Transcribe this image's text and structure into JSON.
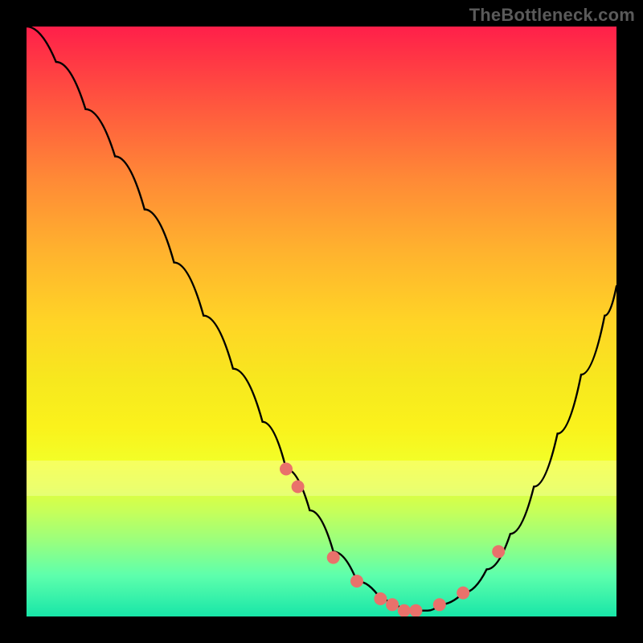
{
  "watermark": "TheBottleneck.com",
  "chart_data": {
    "type": "line",
    "title": "",
    "xlabel": "",
    "ylabel": "",
    "xlim": [
      0,
      100
    ],
    "ylim": [
      0,
      100
    ],
    "grid": false,
    "legend": false,
    "series": [
      {
        "name": "bottleneck-curve",
        "x": [
          0,
          5,
          10,
          15,
          20,
          25,
          30,
          35,
          40,
          44,
          48,
          52,
          56,
          60,
          62,
          64,
          66,
          68,
          70,
          74,
          78,
          82,
          86,
          90,
          94,
          98,
          100
        ],
        "y": [
          100,
          94,
          86,
          78,
          69,
          60,
          51,
          42,
          33,
          25,
          18,
          11,
          6,
          3,
          2,
          1,
          1,
          1,
          2,
          4,
          8,
          14,
          22,
          31,
          41,
          51,
          56
        ]
      }
    ],
    "markers": {
      "name": "threshold-points",
      "x": [
        44,
        46,
        52,
        56,
        60,
        62,
        64,
        66,
        70,
        74,
        80
      ],
      "y": [
        25,
        22,
        10,
        6,
        3,
        2,
        1,
        1,
        2,
        4,
        11
      ]
    },
    "gradient_stops": [
      {
        "pos": 0,
        "color": "#ff1f4a"
      },
      {
        "pos": 14,
        "color": "#ff5a3e"
      },
      {
        "pos": 38,
        "color": "#ffb22e"
      },
      {
        "pos": 60,
        "color": "#f7e81e"
      },
      {
        "pos": 82,
        "color": "#c8ff58"
      },
      {
        "pos": 100,
        "color": "#18e6a8"
      }
    ]
  }
}
